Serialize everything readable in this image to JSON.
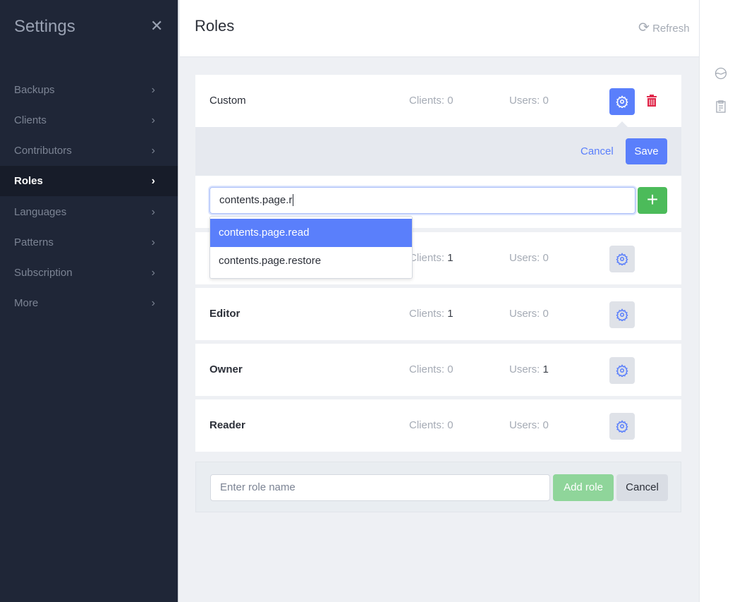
{
  "sidebar": {
    "title": "Settings",
    "items": [
      {
        "label": "Backups"
      },
      {
        "label": "Clients"
      },
      {
        "label": "Contributors"
      },
      {
        "label": "Roles",
        "active": true
      },
      {
        "label": "Languages"
      },
      {
        "label": "Patterns"
      },
      {
        "label": "Subscription"
      },
      {
        "label": "More"
      }
    ]
  },
  "header": {
    "title": "Roles",
    "refresh": "Refresh"
  },
  "colors": {
    "accent": "#5a7ffb",
    "success": "#4cbb5a",
    "danger": "#e0284b",
    "sidebar": "#1f2637"
  },
  "roles": [
    {
      "name": "Custom",
      "clients_label": "Clients:",
      "clients": "0",
      "users_label": "Users:",
      "users": "0"
    },
    {
      "name": "",
      "clients_label": "Clients:",
      "clients": "1",
      "users_label": "Users:",
      "users": "0"
    },
    {
      "name": "Editor",
      "clients_label": "Clients:",
      "clients": "1",
      "users_label": "Users:",
      "users": "0"
    },
    {
      "name": "Owner",
      "clients_label": "Clients:",
      "clients": "0",
      "users_label": "Users:",
      "users": "1"
    },
    {
      "name": "Reader",
      "clients_label": "Clients:",
      "clients": "0",
      "users_label": "Users:",
      "users": "0"
    }
  ],
  "edit": {
    "cancel": "Cancel",
    "save": "Save",
    "permission_value": "contents.page.r",
    "suggestions": [
      "contents.page.read",
      "contents.page.restore"
    ]
  },
  "add_role": {
    "placeholder": "Enter role name",
    "add": "Add role",
    "cancel": "Cancel"
  }
}
